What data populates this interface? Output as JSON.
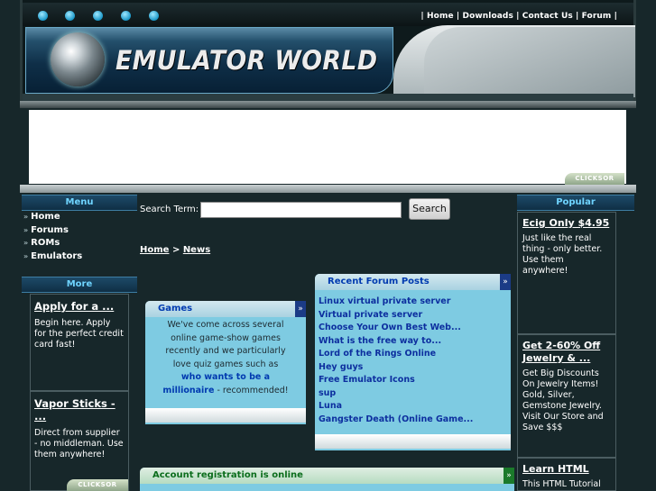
{
  "header": {
    "topnav": [
      "Home",
      "Downloads",
      "Contact Us",
      "Forum"
    ],
    "logo_text": "EMULATOR WORLD"
  },
  "ad_network": "CLICKSOR",
  "left_menu": {
    "heading": "Menu",
    "items": [
      "Home",
      "Forums",
      "ROMs",
      "Emulators"
    ],
    "more_heading": "More",
    "ads": [
      {
        "title": "Apply for a ...",
        "desc": "Begin here. Apply for the perfect credit card fast!"
      },
      {
        "title": "Vapor Sticks - ...",
        "desc": "Direct from supplier - no middleman. Use them anywhere!"
      }
    ]
  },
  "search": {
    "label": "Search Term:",
    "button": "Search",
    "value": ""
  },
  "breadcrumb": {
    "home": "Home",
    "separator": ">",
    "current": "News"
  },
  "games_box": {
    "title": "Games",
    "text_lines": [
      "We've come across several",
      "online game-show games",
      "recently and we particularly",
      "love quiz games such as"
    ],
    "highlight_1": "who wants to be a",
    "highlight_2": "millionaire",
    "tail": " - recommended!"
  },
  "forum_box": {
    "title": "Recent Forum Posts",
    "posts": [
      "Linux virtual private server",
      "Virtual private server",
      "Choose Your Own Best Web...",
      "What is the free way to...",
      "Lord of the Rings Online",
      "Hey guys",
      "Free Emulator Icons",
      "sup",
      "Luna",
      "Gangster Death (Online Game..."
    ]
  },
  "account_box": {
    "title": "Account registration is online"
  },
  "right_column": {
    "heading": "Popular",
    "ads": [
      {
        "title": "Ecig Only $4.95",
        "desc": "Just like the real thing - only better. Use them anywhere!"
      },
      {
        "title": "Get 2-60% Off Jewelry & ...",
        "desc": "Get Big Discounts On Jewelry Items! Gold, Silver, Gemstone Jewelry. Visit Our Store and Save $$$"
      },
      {
        "title": "Learn HTML",
        "desc": "This HTML Tutorial"
      }
    ]
  },
  "colors": {
    "accent_blue": "#003ab0",
    "panel_blue": "#7ecbe2",
    "background": "#17272a",
    "heading_cyan": "#6fd4ff"
  }
}
